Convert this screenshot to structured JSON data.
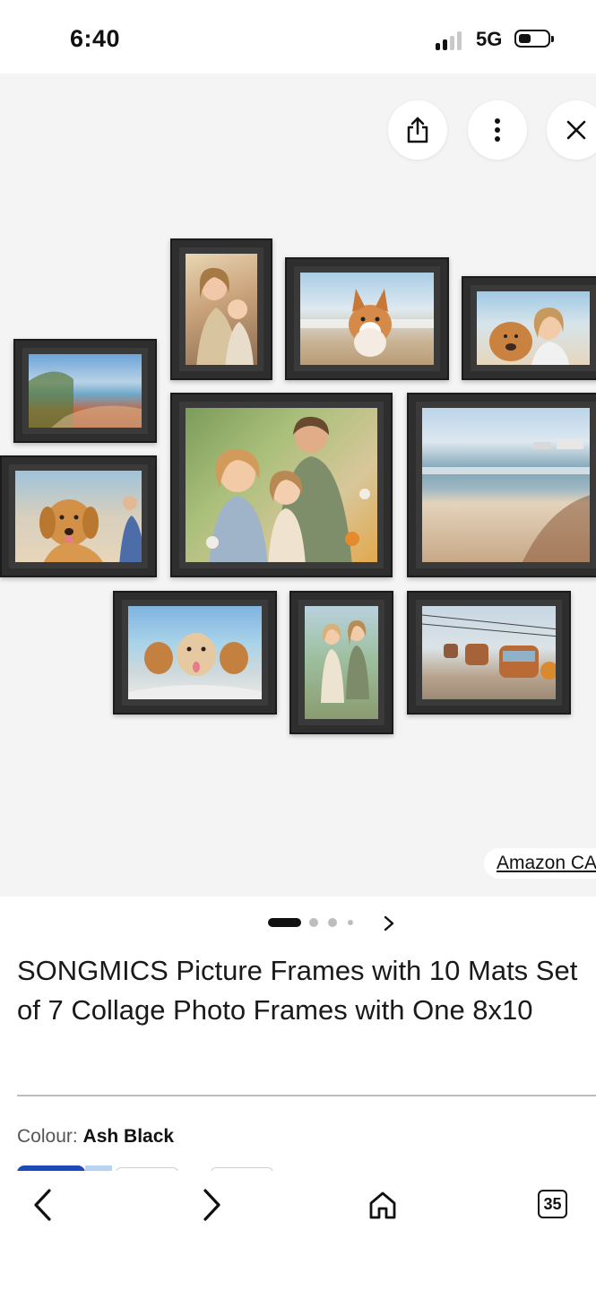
{
  "status_bar": {
    "time": "6:40",
    "network": "5G"
  },
  "gallery": {
    "source_label": "Amazon CA",
    "pager": {
      "total_dots": 4,
      "active_index": 0,
      "next_icon": "chevron-right-icon"
    }
  },
  "product": {
    "title": "SONGMICS Picture Frames with 10 Mats Set of 7 Collage Photo Frames with One 8x10",
    "colour_label": "Colour:",
    "colour_value": "Ash Black"
  },
  "bottom_nav": {
    "tabs_count": "35"
  },
  "colors": {
    "accent": "#1d4ab8",
    "frame": "#2e2e2e",
    "gallery_bg": "#f4f4f4"
  }
}
